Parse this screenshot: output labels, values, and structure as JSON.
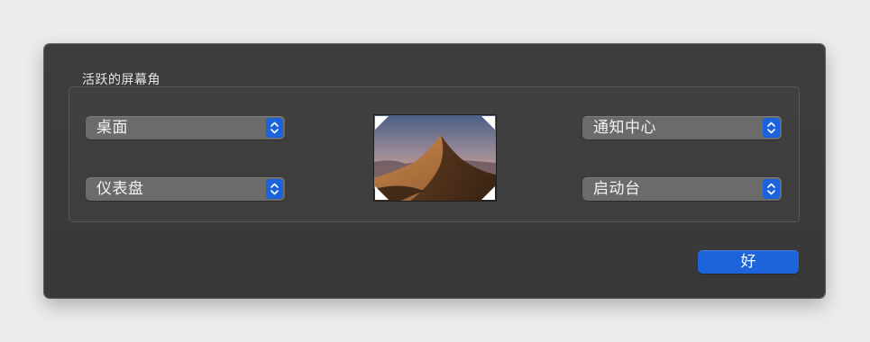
{
  "dialog": {
    "group_title": "活跃的屏幕角",
    "corners": {
      "top_left": "桌面",
      "bottom_left": "仪表盘",
      "top_right": "通知中心",
      "bottom_right": "启动台"
    },
    "preview_image": "mojave-desert-dune-wallpaper",
    "ok_label": "好"
  },
  "colors": {
    "dialog_background": "#3a3a3a",
    "popup_background": "#6b6b6b",
    "accent_blue": "#1d63dc",
    "page_background": "#ececec"
  },
  "icons": {
    "popup_stepper": "chevron-up-down-icon",
    "corner_markers": "corner-triangle-icon"
  }
}
